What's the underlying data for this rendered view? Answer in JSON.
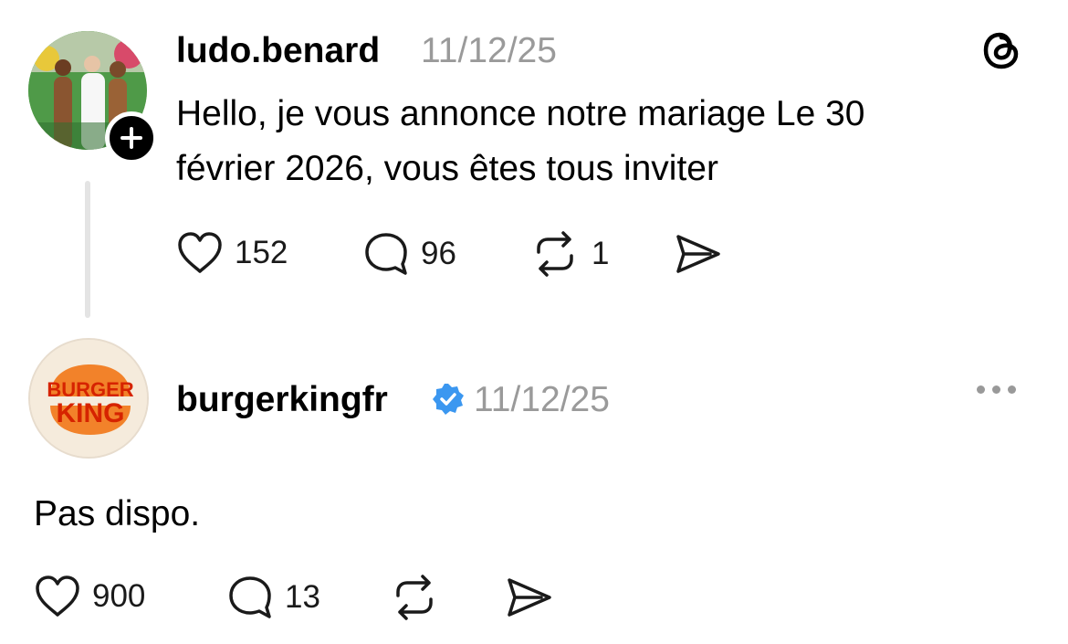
{
  "post": {
    "author": "ludo.benard",
    "date": "11/12/25",
    "text_line1": "Hello,  je vous annonce notre mariage Le 30",
    "text_line2": "février 2026, vous êtes tous inviter",
    "likes": "152",
    "comments": "96",
    "reposts": "1"
  },
  "reply": {
    "author": "burgerkingfr",
    "date": "11/12/25",
    "text": "Pas dispo.",
    "likes": "900",
    "comments": "13",
    "logo_top": "BURGER",
    "logo_bottom": "KING"
  },
  "icons": {
    "follow": "plus-icon",
    "app": "threads-logo-icon",
    "like": "heart-icon",
    "comment": "speech-bubble-icon",
    "repost": "repost-icon",
    "share": "send-icon",
    "verified": "verified-badge-icon",
    "more": "more-horizontal-icon"
  },
  "colors": {
    "timestamp": "#9a9a9a",
    "verified": "#3b97f0",
    "bk_orange": "#f2822a",
    "bk_red": "#d62300",
    "thread_line": "#e4e4e4"
  }
}
